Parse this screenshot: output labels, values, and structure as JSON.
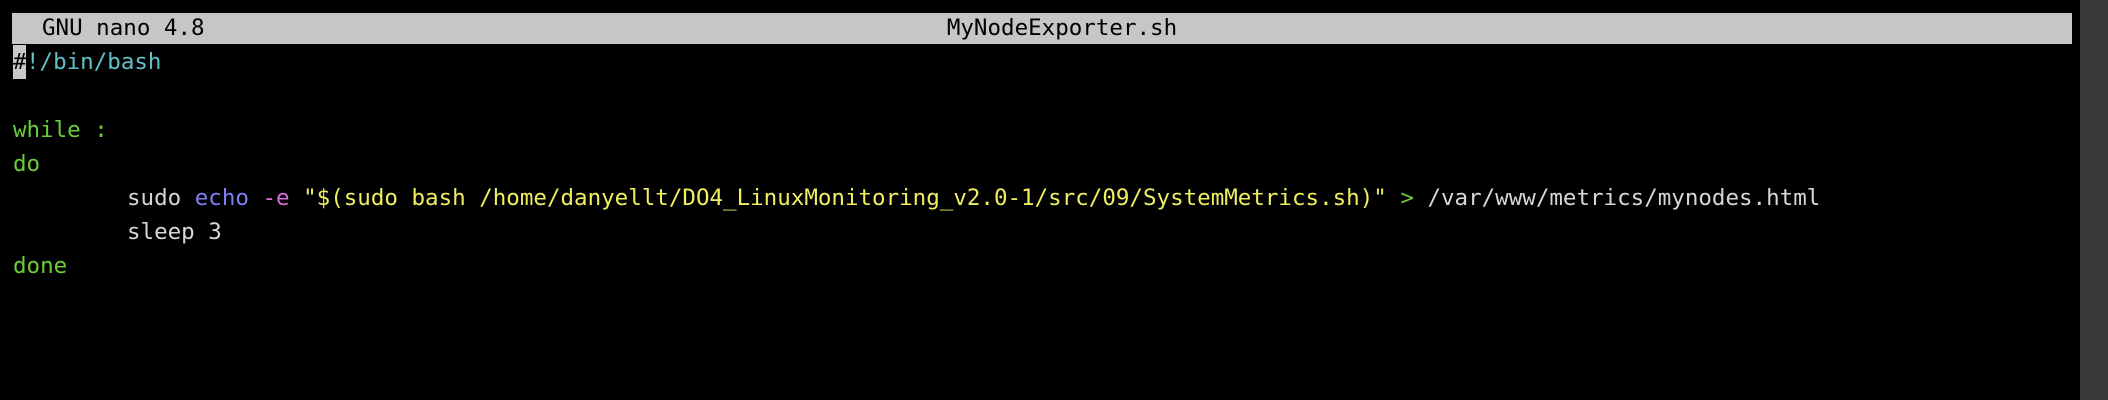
{
  "titlebar": {
    "app_version": "GNU nano 4.8",
    "filename": "MyNodeExporter.sh"
  },
  "editor": {
    "cursor_char": "#",
    "line1_rest": "!/bin/bash",
    "while_kw": "while :",
    "do_kw": "do",
    "cmd_sudo": "sudo ",
    "cmd_echo": "echo",
    "cmd_flag": "-e",
    "cmd_string": "\"$(sudo bash /home/danyellt/DO4_LinuxMonitoring_v2.0-1/src/09/SystemMetrics.sh)\"",
    "cmd_redirect": ">",
    "cmd_target": "/var/www/metrics/mynodes.html",
    "sleep_cmd": "sleep 3",
    "done_kw": "done"
  },
  "colors": {
    "shebang": "#5fc0c8",
    "keyword": "#6ccb3a",
    "builtin": "#7f7ff5",
    "flag": "#d46cd6",
    "string": "#f0ee60",
    "titlebar_bg": "#c6c6c6",
    "background": "#000000"
  }
}
